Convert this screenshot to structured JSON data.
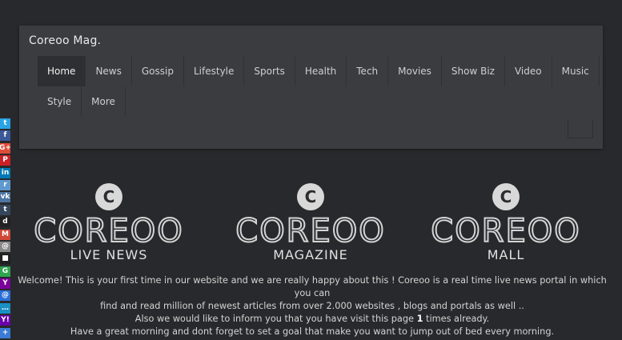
{
  "header": {
    "brand": "Coreoo Mag."
  },
  "nav": {
    "row1": [
      "Home",
      "News",
      "Gossip",
      "Lifestyle",
      "Sports",
      "Health",
      "Tech",
      "Movies",
      "Show Biz",
      "Video",
      "Music"
    ],
    "row2": [
      "Style",
      "More"
    ],
    "active": "Home"
  },
  "logos": [
    {
      "mark": "C",
      "word": "COREOO",
      "sub": "LIVE NEWS"
    },
    {
      "mark": "C",
      "word": "COREOO",
      "sub": "MAGAZINE"
    },
    {
      "mark": "C",
      "word": "COREOO",
      "sub": "MALL"
    }
  ],
  "welcome": {
    "line1": "Welcome! This is your first time in our website and we are really happy about this ! Coreoo is a real time live news portal in which you can",
    "line2": "find and read million of newest articles from over 2.000 websites , blogs and portals as well ..",
    "line3_pre": "Also we would like to inform you that you have visit this page",
    "visit_count": "1",
    "line3_post": "times already.",
    "line4": "Have a great morning and dont forget to set a goal that make you want to jump out of bed every morning."
  },
  "social": [
    {
      "name": "twitter-icon",
      "glyph": "t",
      "color": "#2aa3e6"
    },
    {
      "name": "facebook-icon",
      "glyph": "f",
      "color": "#3b5998"
    },
    {
      "name": "google-plus-icon",
      "glyph": "G+",
      "color": "#dd4b39"
    },
    {
      "name": "pinterest-icon",
      "glyph": "P",
      "color": "#cb2027"
    },
    {
      "name": "linkedin-icon",
      "glyph": "in",
      "color": "#0077b5"
    },
    {
      "name": "reddit-icon",
      "glyph": "r",
      "color": "#5f99cf"
    },
    {
      "name": "vk-icon",
      "glyph": "vk",
      "color": "#4c75a3"
    },
    {
      "name": "tumblr-icon",
      "glyph": "t",
      "color": "#35465c"
    },
    {
      "name": "digg-icon",
      "glyph": "d",
      "color": "#222222"
    },
    {
      "name": "gmail-icon",
      "glyph": "M",
      "color": "#d14836"
    },
    {
      "name": "email-icon",
      "glyph": "@",
      "color": "#888888"
    },
    {
      "name": "delicious-icon",
      "glyph": "■",
      "color": "#1f1f1f"
    },
    {
      "name": "google-icon",
      "glyph": "G",
      "color": "#2fa44f"
    },
    {
      "name": "yahoo-icon",
      "glyph": "Y",
      "color": "#7b0099"
    },
    {
      "name": "aol-mail-icon",
      "glyph": "@",
      "color": "#2a6fd6"
    },
    {
      "name": "chat-icon",
      "glyph": "…",
      "color": "#1a8fc4"
    },
    {
      "name": "yahoo-mail-icon",
      "glyph": "Y!",
      "color": "#6a00a8"
    },
    {
      "name": "share-icon",
      "glyph": "+",
      "color": "#3b7bd4"
    }
  ]
}
